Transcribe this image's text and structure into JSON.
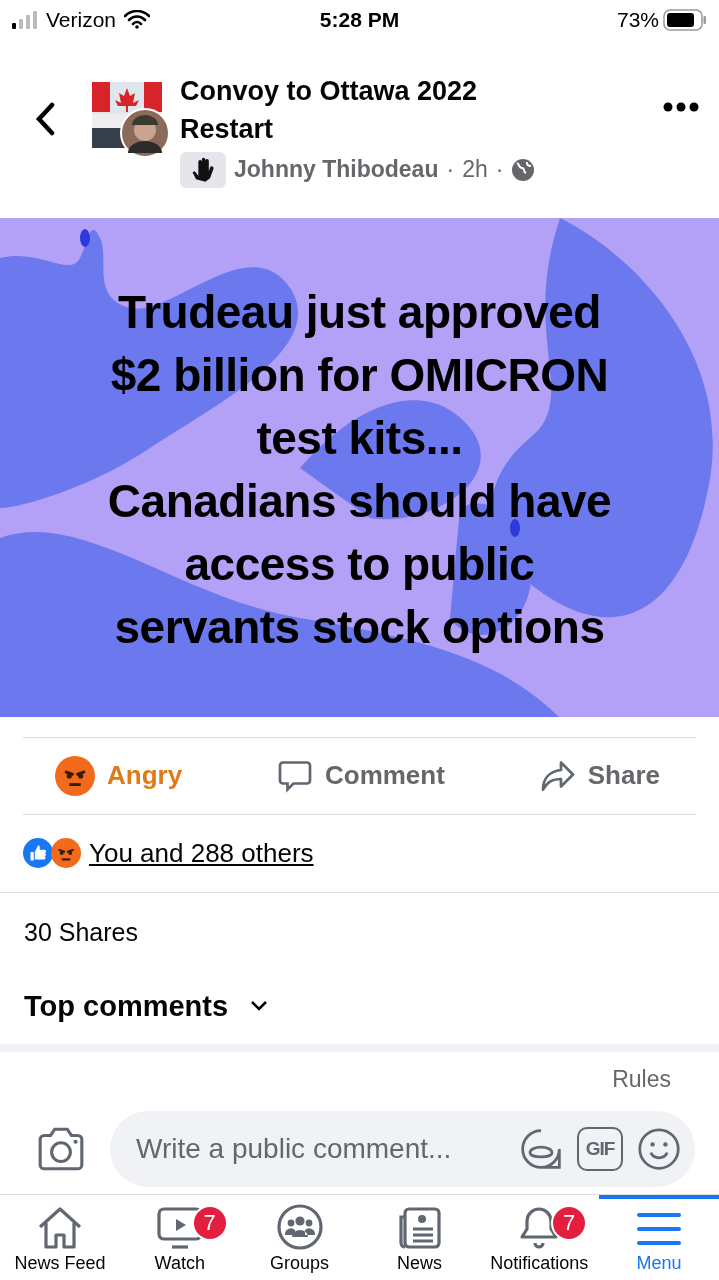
{
  "status_bar": {
    "carrier": "Verizon",
    "time": "5:28 PM",
    "battery": "73%"
  },
  "post": {
    "group": "Convoy to Ottawa 2022 Restart",
    "author": "Johnny Thibodeau",
    "separator_1": "·",
    "time": "2h",
    "separator_2": "·"
  },
  "image_text": [
    "Trudeau just approved",
    "$2 billion for OMICRON",
    "test kits...",
    "Canadians should have",
    "access to public",
    "servants stock options"
  ],
  "actions": [
    {
      "kind": "angry",
      "label": "Angry",
      "selected": true
    },
    {
      "kind": "comment",
      "label": "Comment",
      "selected": false
    },
    {
      "kind": "share",
      "label": "Share",
      "selected": false
    }
  ],
  "reactions": "You and 288 others",
  "shares": "30 Shares",
  "comments_filter": "Top comments",
  "rules": "Rules",
  "composer": {
    "placeholder": "Write a public comment...",
    "gif": "GIF"
  },
  "tabs": [
    {
      "kind": "home",
      "label": "News Feed",
      "selected": false
    },
    {
      "kind": "watch",
      "label": "Watch",
      "badge": "7",
      "selected": false
    },
    {
      "kind": "groups",
      "label": "Groups",
      "selected": false
    },
    {
      "kind": "news",
      "label": "News",
      "selected": false
    },
    {
      "kind": "bell",
      "label": "Notifications",
      "badge": "7",
      "selected": false
    },
    {
      "kind": "menu",
      "label": "Menu",
      "selected": true
    }
  ]
}
